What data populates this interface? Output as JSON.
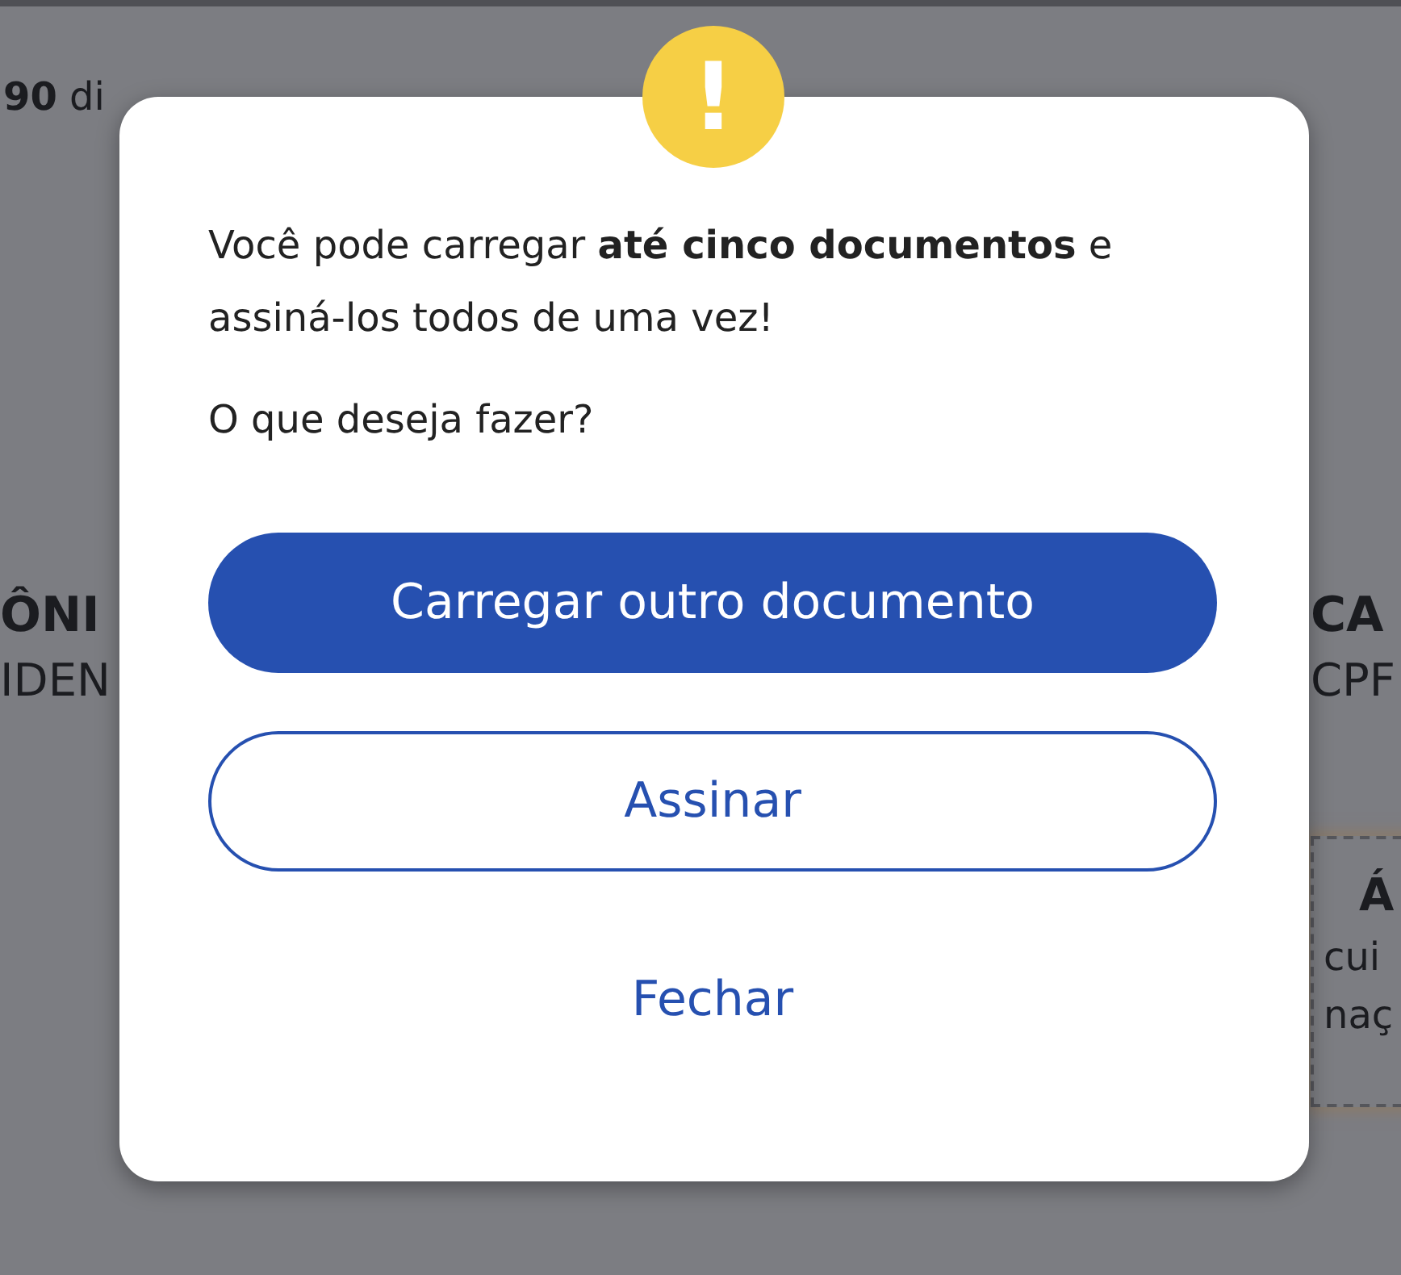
{
  "background": {
    "top_text": "**90** di",
    "left_block": {
      "heading": "ÔNI",
      "subtitle": "IDEN"
    },
    "right_block": {
      "heading": "CA",
      "subtitle": "CPF"
    },
    "notice": {
      "heading": "Á",
      "lines": [
        "cui",
        "naç"
      ]
    }
  },
  "modal": {
    "icon": "!",
    "message": "Você pode carregar **até cinco documentos** e assiná-los todos de uma vez!",
    "question": "O que deseja fazer?",
    "buttons": [
      {
        "label": "Carregar outro documento",
        "kind": "primary"
      },
      {
        "label": "Assinar",
        "kind": "outline"
      },
      {
        "label": "Fechar",
        "kind": "link"
      }
    ]
  }
}
